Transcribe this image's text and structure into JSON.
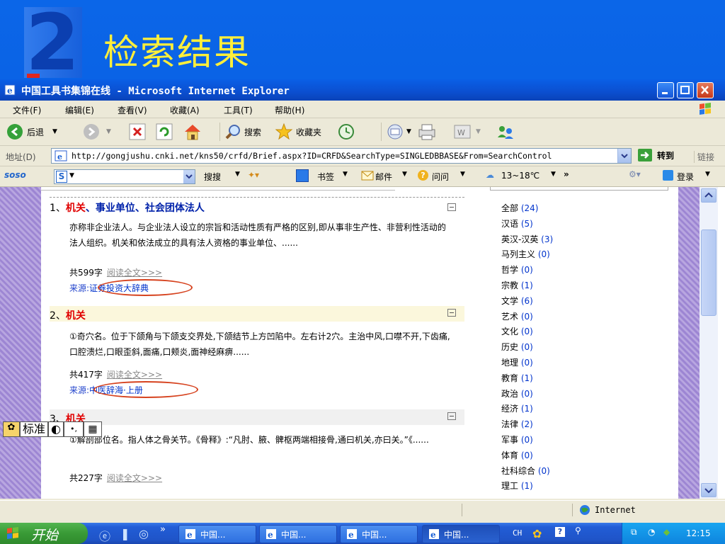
{
  "slide": {
    "title": "检索结果"
  },
  "window": {
    "title": "中国工具书集锦在线 - Microsoft Internet Explorer",
    "menu": [
      "文件(F)",
      "编辑(E)",
      "查看(V)",
      "收藏(A)",
      "工具(T)",
      "帮助(H)"
    ],
    "toolbar": {
      "back": "后退",
      "search": "搜索",
      "favorites": "收藏夹"
    },
    "address": {
      "label": "地址(D)",
      "url": "http://gongjushu.cnki.net/kns50/crfd/Brief.aspx?ID=CRFD&SearchType=SINGLEDBBASE&From=SearchControl",
      "go": "转到",
      "links": "链接"
    },
    "soso": {
      "logo": "soso",
      "s_label": "S",
      "search_btn": "搜搜",
      "bookmark": "书签",
      "mail": "邮件",
      "ask": "问问",
      "weather": "13~18℃",
      "more": "»",
      "login": "登录"
    },
    "status": {
      "zone": "Internet"
    }
  },
  "ime": {
    "label": "标准",
    "punct": "•,",
    "kb": "▦"
  },
  "results": [
    {
      "num": "1、",
      "keyword": "机关",
      "rest": "、事业单位、社会团体法人",
      "body": "亦称非企业法人。与企业法人设立的宗旨和活动性质有严格的区别,即从事非生产性、非营利性活动的法人组织。机关和依法成立的具有法人资格的事业单位、......",
      "count": "共599字",
      "read": "阅读全文>>>",
      "source_label": "来源:",
      "source": "证券投资大辞典"
    },
    {
      "num": "2、",
      "keyword": "机关",
      "rest": "",
      "body": "①奇穴名。位于下颌角与下颌支交界处,下颌结节上方凹陷中。左右计2穴。主治中风,口噤不开,下齿痛,口腔溃烂,口眼歪斜,面痛,口颊炎,面神经麻痹......",
      "count": "共417字",
      "read": "阅读全文>>>",
      "source_label": "来源:",
      "source": "中医辞海·上册"
    },
    {
      "num": "3、",
      "keyword": "机关",
      "rest": "",
      "body": "①解剖部位名。指人体之骨关节。《骨释》:“凡肘、腋、髀枢两端相接骨,通曰机关,亦曰关。”《......",
      "count": "共227字",
      "read": "阅读全文>>>",
      "source_label": "",
      "source": ""
    }
  ],
  "categories": [
    {
      "name": "全部",
      "count": "(24)"
    },
    {
      "name": "汉语",
      "count": "(5)"
    },
    {
      "name": "英汉-汉英",
      "count": "(3)"
    },
    {
      "name": "马列主义",
      "count": "(0)"
    },
    {
      "name": "哲学",
      "count": "(0)"
    },
    {
      "name": "宗教",
      "count": "(1)"
    },
    {
      "name": "文学",
      "count": "(6)"
    },
    {
      "name": "艺术",
      "count": "(0)"
    },
    {
      "name": "文化",
      "count": "(0)"
    },
    {
      "name": "历史",
      "count": "(0)"
    },
    {
      "name": "地理",
      "count": "(0)"
    },
    {
      "name": "教育",
      "count": "(1)"
    },
    {
      "name": "政治",
      "count": "(0)"
    },
    {
      "name": "经济",
      "count": "(1)"
    },
    {
      "name": "法律",
      "count": "(2)"
    },
    {
      "name": "军事",
      "count": "(0)"
    },
    {
      "name": "体育",
      "count": "(0)"
    },
    {
      "name": "社科综合",
      "count": "(0)"
    },
    {
      "name": "理工",
      "count": "(1)"
    }
  ],
  "taskbar": {
    "start": "开始",
    "tasks": [
      "中国...",
      "中国...",
      "中国...",
      "中国..."
    ],
    "lang": "CH",
    "time": "12:15"
  }
}
